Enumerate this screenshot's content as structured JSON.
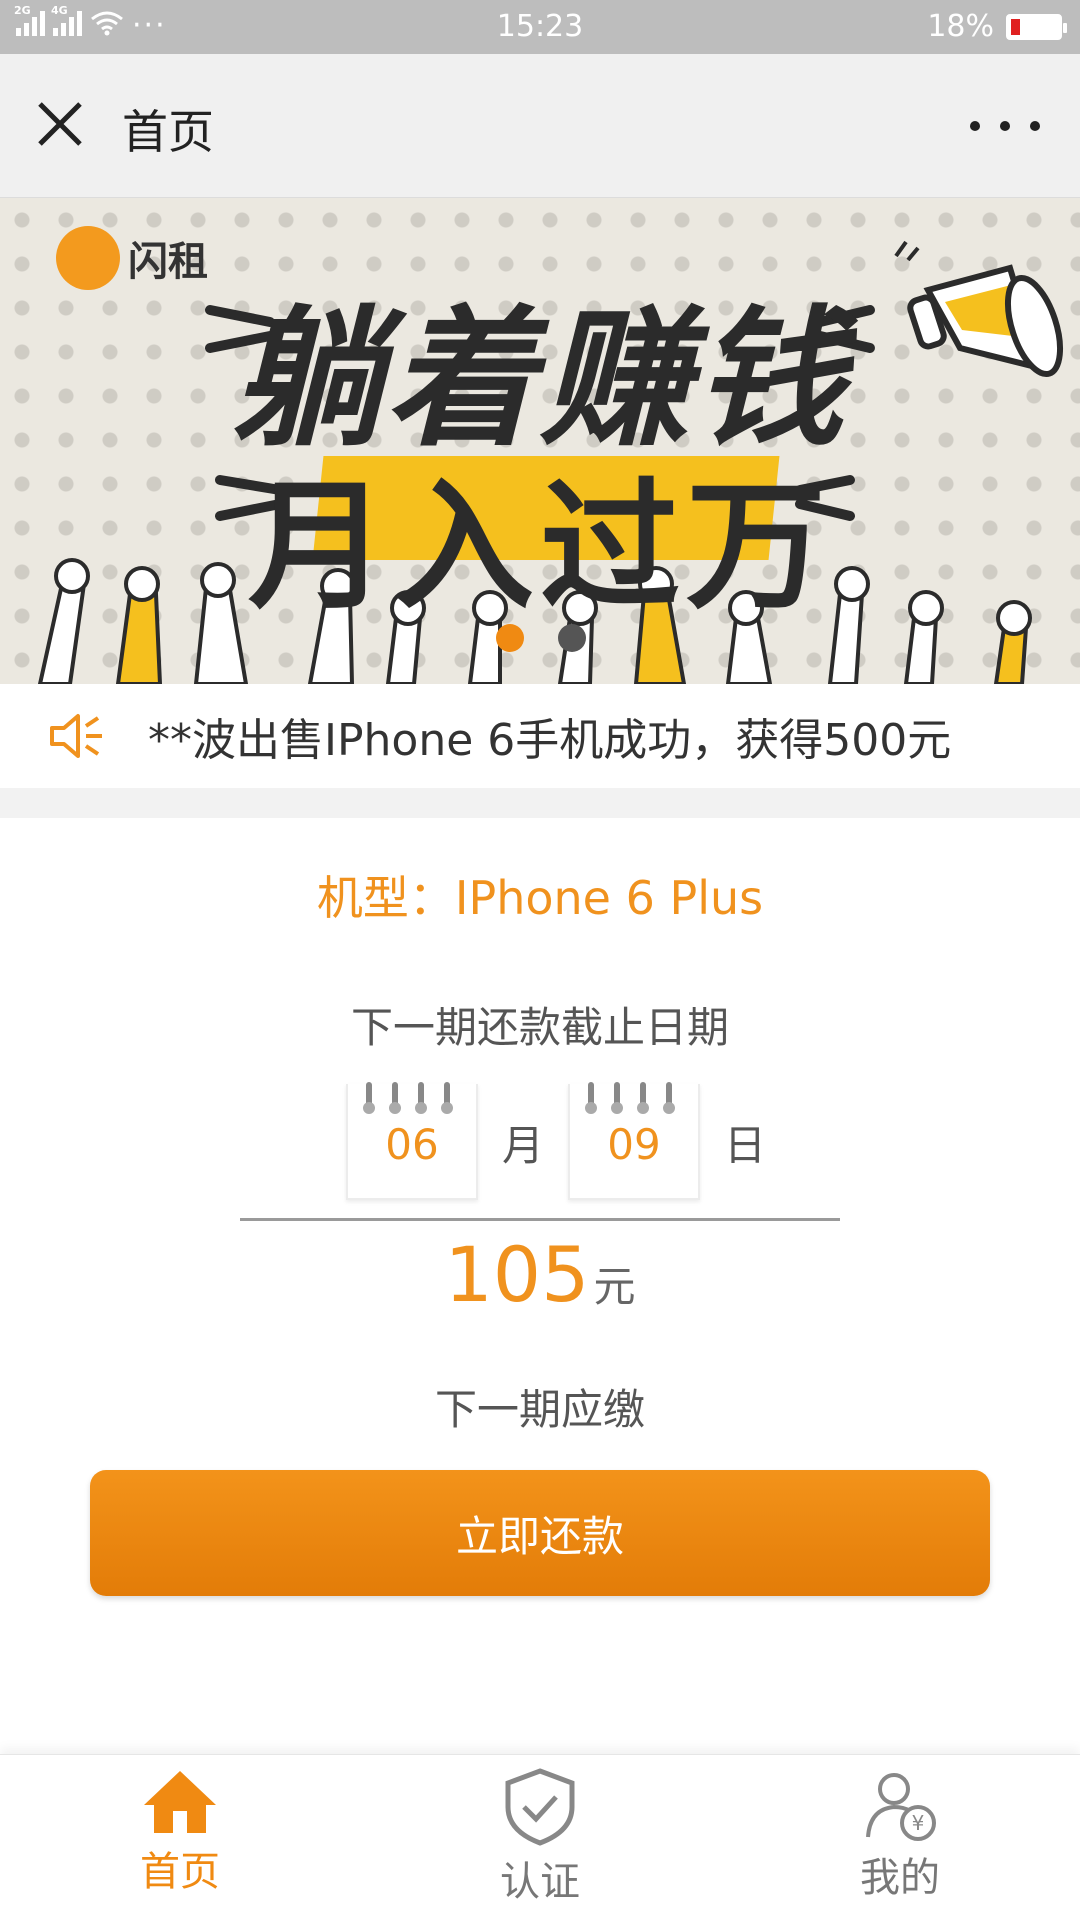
{
  "status_bar": {
    "network_1": "2G",
    "network_2": "4G",
    "time": "15:23",
    "battery_percent": "18%",
    "battery_level": 0.18
  },
  "nav": {
    "title": "首页"
  },
  "banner": {
    "brand": "闪租",
    "headline_1": "躺着赚钱",
    "headline_2": "月入过万",
    "slide_count": 2,
    "active_slide": 0
  },
  "notice": {
    "text": "**波出售IPhone 6手机成功，获得500元"
  },
  "main": {
    "model_line": "机型：IPhone 6 Plus",
    "due_label": "下一期还款截止日期",
    "month": "06",
    "month_unit": "月",
    "day": "09",
    "day_unit": "日",
    "amount": "105",
    "amount_unit": "元",
    "next_label": "下一期应缴",
    "pay_button": "立即还款"
  },
  "tabs": [
    {
      "label": "首页",
      "icon": "home-icon",
      "active": true
    },
    {
      "label": "认证",
      "icon": "shield-check-icon",
      "active": false
    },
    {
      "label": "我的",
      "icon": "user-yuan-icon",
      "active": false
    }
  ],
  "colors": {
    "accent": "#f08a12",
    "headline_highlight": "#f5c01e",
    "status_bar": "#bdbdbd"
  }
}
